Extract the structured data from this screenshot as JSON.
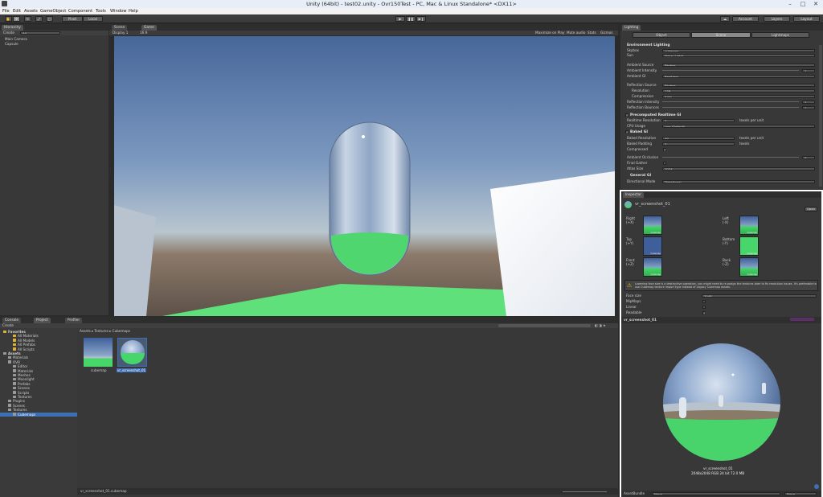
{
  "window": {
    "title": "Unity (64bit) - test02.unity - Ovr150Test - PC, Mac & Linux Standalone* <DX11>",
    "min": "–",
    "max": "□",
    "close": "✕"
  },
  "menu": [
    "File",
    "Edit",
    "Assets",
    "GameObject",
    "Component",
    "Tools",
    "Window",
    "Help"
  ],
  "toolbar": {
    "pivot": "Pivot",
    "local": "Local",
    "account": "Account",
    "layers": "Layers",
    "layout": "Layout",
    "play": "▶",
    "pause": "❚❚",
    "step": "▶❙"
  },
  "hierarchy": {
    "tab": "Hierarchy",
    "create": "Create",
    "search": "All",
    "items": [
      "Main Camera",
      "Capsule"
    ]
  },
  "scene_tabs": {
    "scene": "Scene",
    "game": "Game",
    "display": "Display 1",
    "aspect": "16:9",
    "maximize": "Maximize on Play",
    "mute": "Mute audio",
    "stats": "Stats",
    "gizmos": "Gizmos"
  },
  "lighting": {
    "tab": "Lighting",
    "subtabs": [
      "Object",
      "Scene",
      "Lightmaps"
    ],
    "env": "Environment Lighting",
    "rows": [
      {
        "label": "Skybox",
        "value": "cubemap"
      },
      {
        "label": "Sun",
        "value": "None (Light)"
      },
      {
        "label": "Ambient Source",
        "value": "Skybox"
      },
      {
        "label": "Ambient Intensity",
        "value": "1"
      },
      {
        "label": "Ambient GI",
        "value": "Realtime"
      },
      {
        "label": "Reflection Source",
        "value": "Skybox"
      },
      {
        "label": "Resolution",
        "value": "128"
      },
      {
        "label": "Compression",
        "value": "Auto"
      },
      {
        "label": "Reflection Intensity",
        "value": "1"
      },
      {
        "label": "Reflection Bounces",
        "value": "1"
      }
    ],
    "precomputed": "Precomputed Realtime GI",
    "rt_res_label": "Realtime Resolution",
    "rt_res_value": "2",
    "texels": "texels per unit",
    "cpu_label": "CPU Usage",
    "cpu_value": "Low (Default)",
    "baked": "Baked GI",
    "baked_rows": [
      {
        "label": "Baked Resolution",
        "value": "40",
        "unit": "texels per unit"
      },
      {
        "label": "Baked Padding",
        "value": "2",
        "unit": "texels"
      },
      {
        "label": "Compressed",
        "value": "✓",
        "unit": ""
      },
      {
        "label": "Ambient Occlusion",
        "value": "0",
        "unit": ""
      },
      {
        "label": "Final Gather",
        "value": "",
        "unit": ""
      },
      {
        "label": "Atlas Size",
        "value": "1024",
        "unit": ""
      }
    ],
    "general": "General GI",
    "directional_label": "Directional Mode",
    "directional_value": "Directional"
  },
  "inspector": {
    "tab": "Inspector",
    "asset": "vr_screenshot_01",
    "open": "Open",
    "faces": [
      {
        "label": "Right\n(+X)",
        "name": "Cubemap"
      },
      {
        "label": "Left\n(-X)",
        "name": "Cubemap"
      },
      {
        "label": "Top\n(+Y)",
        "name": "Cubemap"
      },
      {
        "label": "Bottom\n(-Y)",
        "name": "Cubemap"
      },
      {
        "label": "Front\n(+Z)",
        "name": "Cubemap"
      },
      {
        "label": "Back\n(-Z)",
        "name": "Cubemap"
      }
    ],
    "warning": "Lowering face size is a destructive operation, you might need to re-assign the textures later to fix resolution issues. It's preferable to use Cubemap texture import type instead of Legacy Cubemap assets.",
    "face_size_label": "Face size",
    "face_size_value": "2048",
    "mipmaps_label": "MipMaps",
    "linear_label": "Linear",
    "readable_label": "Readable",
    "readable_check": "✓",
    "preview_title": "vr_screenshot_01",
    "preview_name": "vr_screenshot_01",
    "preview_info": "2048x2048  RGB 24 bit  72.0 MB",
    "assetbundle_label": "AssetBundle",
    "assetbundle_value": "None",
    "variant_value": "None"
  },
  "project": {
    "tabs": [
      "Console",
      "Project",
      "Profiler"
    ],
    "create": "Create",
    "breadcrumb": "Assets ▸ Textures ▸ Cubemaps",
    "tree": [
      {
        "label": "Favorites",
        "indent": 0,
        "bold": true
      },
      {
        "label": "All Materials",
        "indent": 2
      },
      {
        "label": "All Models",
        "indent": 2
      },
      {
        "label": "All Prefabs",
        "indent": 2
      },
      {
        "label": "All Scripts",
        "indent": 2
      },
      {
        "label": "Assets",
        "indent": 0,
        "bold": true
      },
      {
        "label": "Materials",
        "indent": 1
      },
      {
        "label": "OVR",
        "indent": 1
      },
      {
        "label": "Editor",
        "indent": 2
      },
      {
        "label": "Materials",
        "indent": 2
      },
      {
        "label": "Meshes",
        "indent": 2
      },
      {
        "label": "Moonlight",
        "indent": 2
      },
      {
        "label": "Prefabs",
        "indent": 2
      },
      {
        "label": "Scenes",
        "indent": 2
      },
      {
        "label": "Scripts",
        "indent": 2
      },
      {
        "label": "Textures",
        "indent": 2
      },
      {
        "label": "Plugins",
        "indent": 1
      },
      {
        "label": "Scenes",
        "indent": 1
      },
      {
        "label": "Textures",
        "indent": 1
      },
      {
        "label": "Cubemaps",
        "indent": 2,
        "selected": true
      }
    ],
    "files": [
      {
        "label": "cubemap"
      },
      {
        "label": "vr_screenshot_01",
        "selected": true
      }
    ],
    "status": "vr_screenshot_01.cubemap"
  },
  "colors": {
    "accent": "#3d6fb4",
    "bg": "#383838",
    "dark": "#2b2b2b",
    "green": "#46d669",
    "highlight": "#ffffff"
  }
}
